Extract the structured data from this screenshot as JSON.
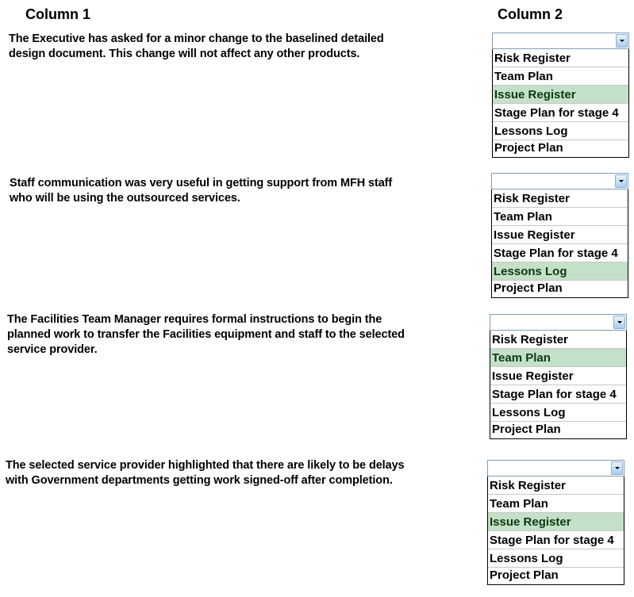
{
  "headers": {
    "column1": "Column 1",
    "column2": "Column 2"
  },
  "accent": {
    "selected_bg": "#c5e0c8",
    "selected_text": "#0a3a10",
    "dropdown_border": "#7f9db9"
  },
  "rows": [
    {
      "question": [
        "The Executive has asked for a minor change to the baselined detailed",
        "design document. This change will not affect any other products."
      ],
      "dropdown": {
        "value": "",
        "selected_index": 2,
        "options": [
          "Risk Register",
          "Team Plan",
          "Issue Register",
          "Stage Plan for stage 4",
          "Lessons Log",
          "Project Plan"
        ]
      }
    },
    {
      "question": [
        "Staff communication was very useful in getting support from MFH staff",
        "who will be using the outsourced services."
      ],
      "dropdown": {
        "value": "",
        "selected_index": 4,
        "options": [
          "Risk Register",
          "Team Plan",
          "Issue Register",
          "Stage Plan for stage 4",
          "Lessons Log",
          "Project Plan"
        ]
      }
    },
    {
      "question": [
        "The Facilities Team Manager requires formal instructions to begin the",
        "planned work to transfer the Facilities equipment and staff to the selected",
        "service provider."
      ],
      "dropdown": {
        "value": "",
        "selected_index": 1,
        "options": [
          "Risk Register",
          "Team Plan",
          "Issue Register",
          "Stage Plan for stage 4",
          "Lessons Log",
          "Project Plan"
        ]
      }
    },
    {
      "question": [
        "The selected service provider highlighted that there are likely to be delays",
        "with Government departments getting work signed-off after completion."
      ],
      "dropdown": {
        "value": "",
        "selected_index": 2,
        "options": [
          "Risk Register",
          "Team Plan",
          "Issue Register",
          "Stage Plan for stage 4",
          "Lessons Log",
          "Project Plan"
        ]
      }
    }
  ]
}
